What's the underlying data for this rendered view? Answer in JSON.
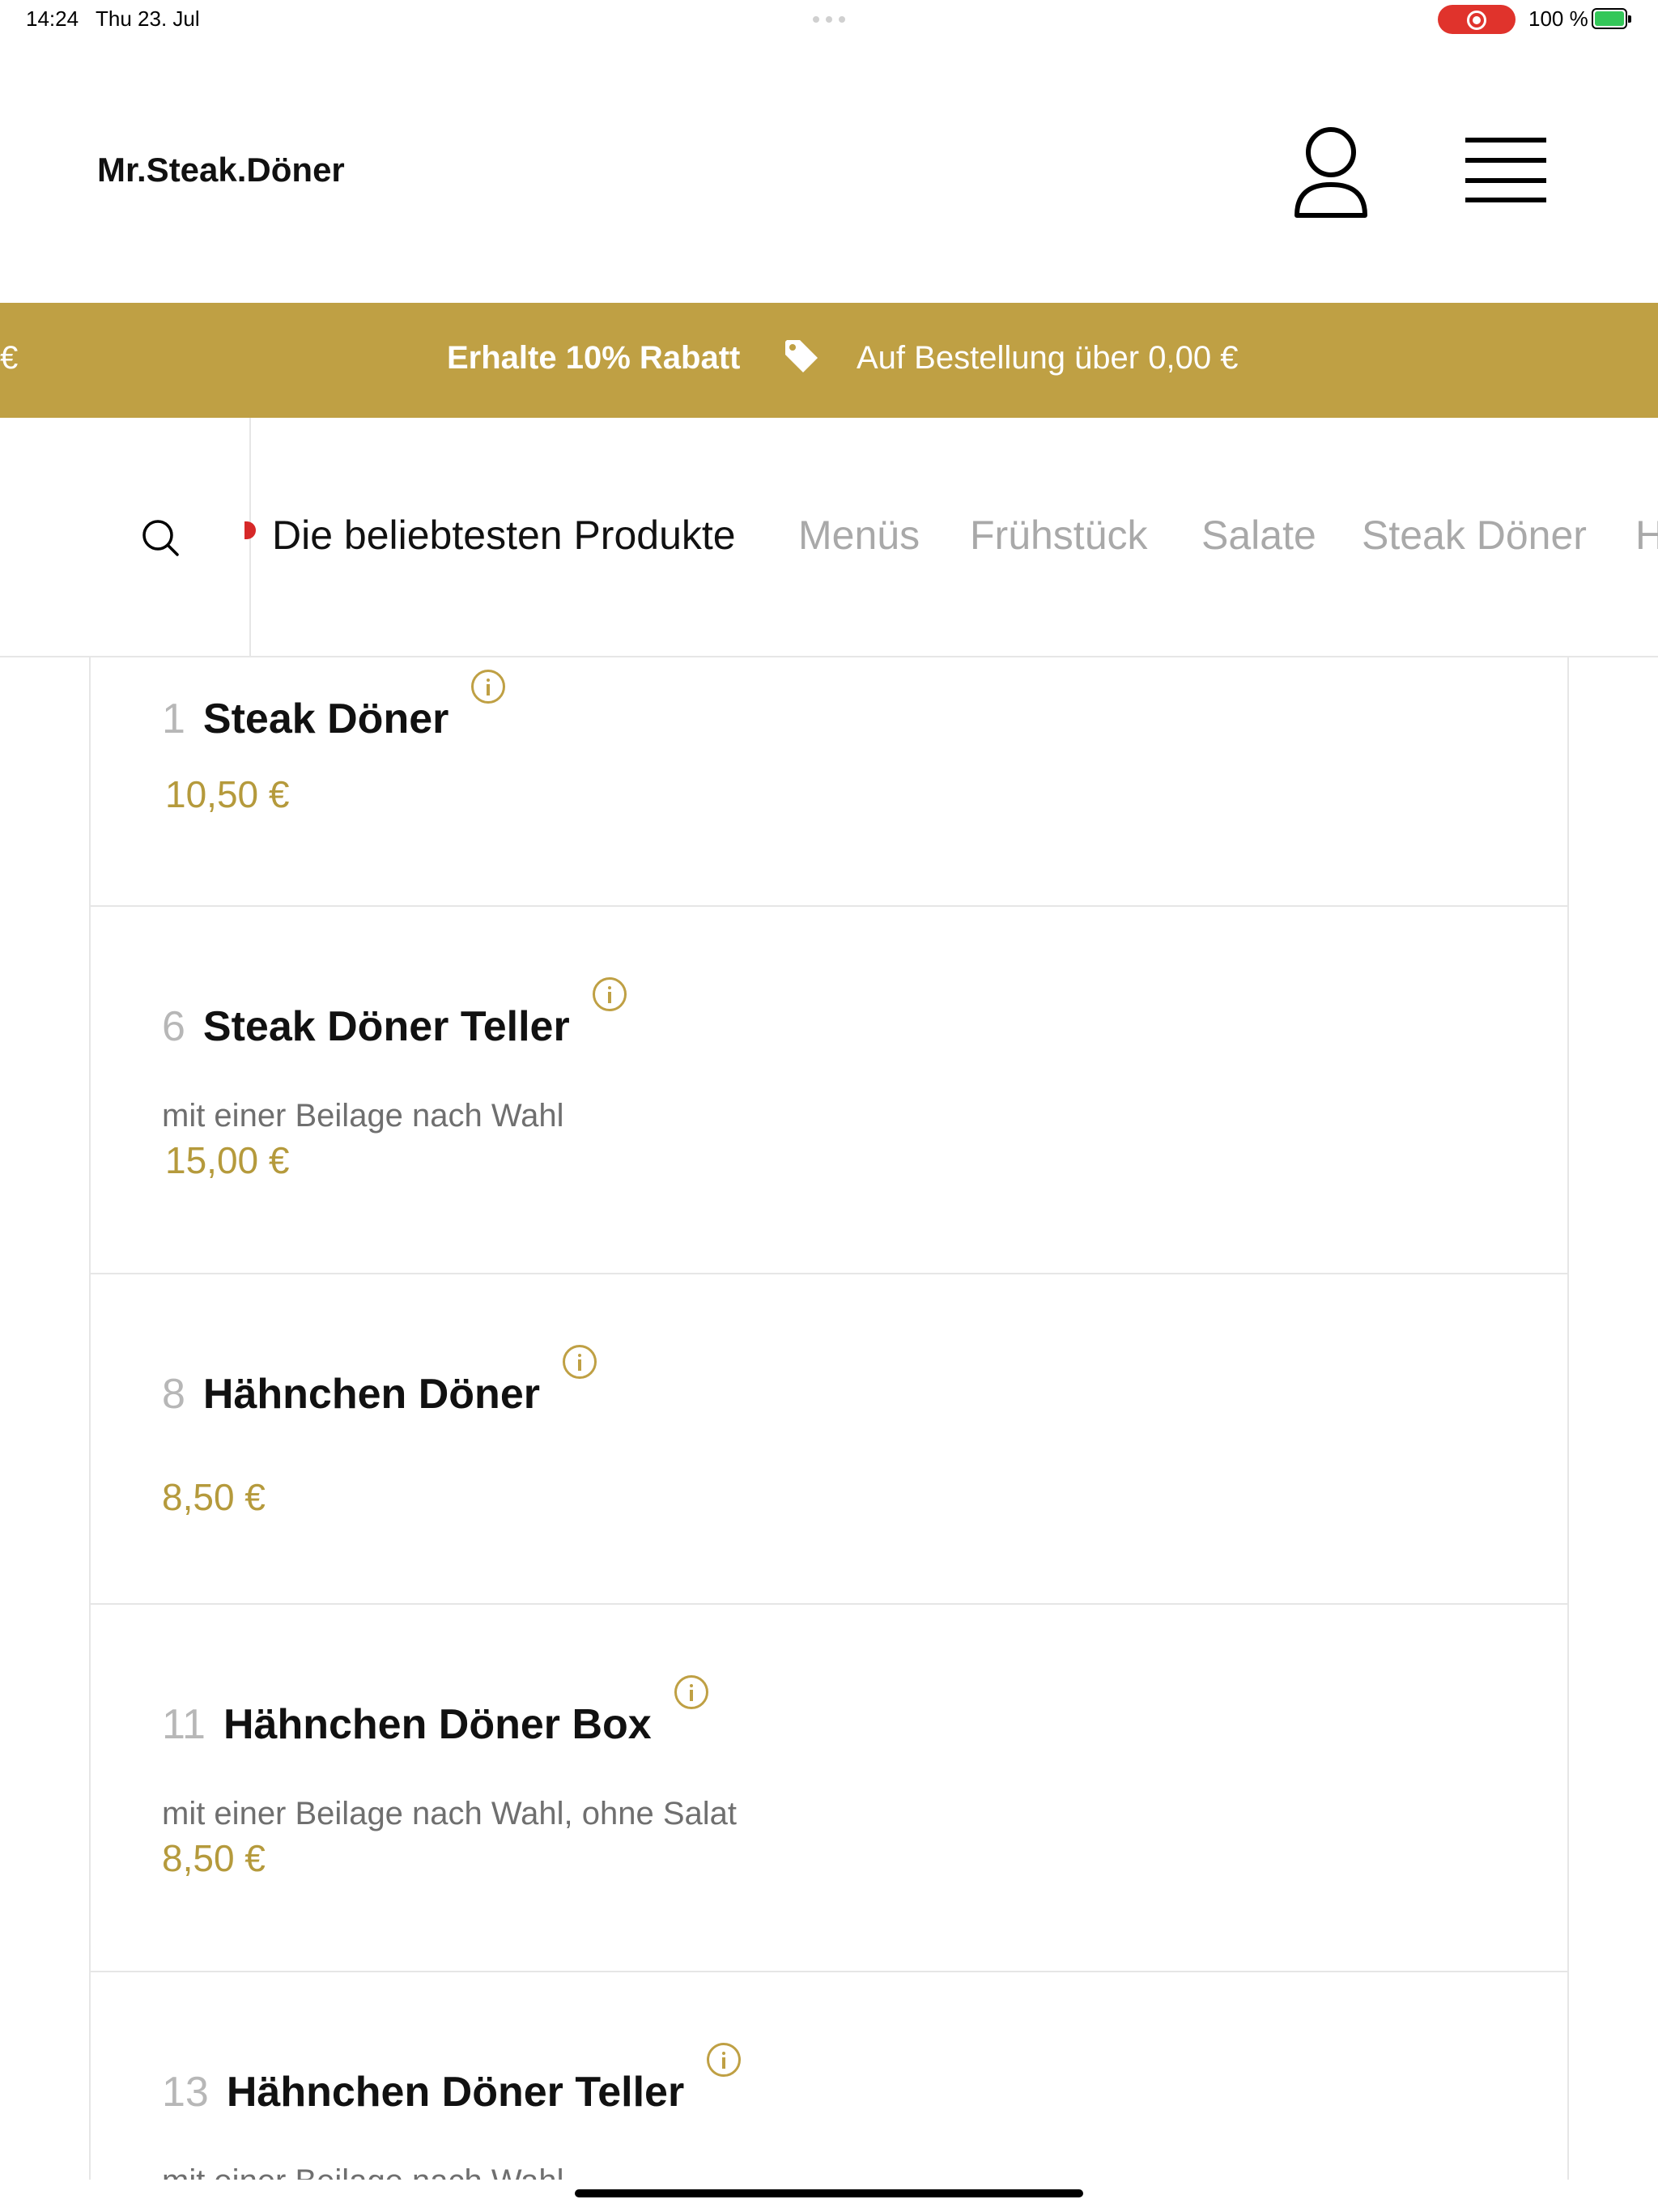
{
  "status_bar": {
    "time": "14:24",
    "date": "Thu 23. Jul",
    "battery": "100 %",
    "battery_level": 1.0,
    "recording_color": "#e0332c"
  },
  "header": {
    "brand": "Mr.Steak.Döner",
    "user_icon": "user-icon",
    "menu_icon": "hamburger-menu-icon"
  },
  "promo": {
    "edge_text": "€",
    "title": "Erhalte 10% Rabatt",
    "tag_icon": "tag-icon",
    "text": "Auf Bestellung über 0,00 €",
    "color": "#bfa044"
  },
  "categories": {
    "search_icon": "search-icon",
    "items": [
      {
        "label": "Die beliebtesten Produkte",
        "active": true
      },
      {
        "label": "Menüs",
        "active": false
      },
      {
        "label": "Frühstück",
        "active": false
      },
      {
        "label": "Salate",
        "active": false
      },
      {
        "label": "Steak Döner",
        "active": false
      },
      {
        "label": "H",
        "active": false
      }
    ]
  },
  "products": [
    {
      "number": "1",
      "name": "Steak Döner",
      "description": "",
      "price": "10,50 €"
    },
    {
      "number": "6",
      "name": "Steak Döner Teller",
      "description": "mit einer Beilage nach Wahl",
      "price": "15,00 €"
    },
    {
      "number": "8",
      "name": "Hähnchen Döner",
      "description": "",
      "price": "8,50 €"
    },
    {
      "number": "11",
      "name": "Hähnchen Döner Box",
      "description": "mit einer Beilage nach Wahl, ohne Salat",
      "price": "8,50 €"
    },
    {
      "number": "13",
      "name": "Hähnchen Döner Teller",
      "description": "mit einer Beilage nach Wahl",
      "price": ""
    }
  ],
  "colors": {
    "accent": "#bfa044",
    "price": "#b59a3c",
    "muted": "#a9a9a9"
  }
}
